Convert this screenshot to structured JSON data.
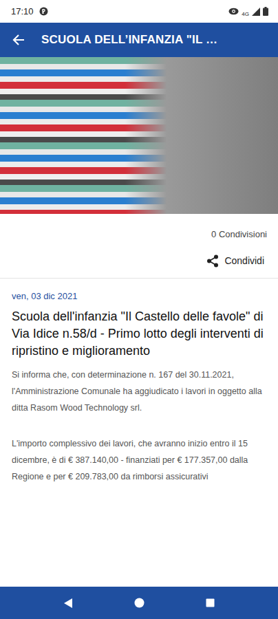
{
  "status_bar": {
    "time": "17:10",
    "network": "4G"
  },
  "app_bar": {
    "title": "SCUOLA DELL’INFANZIA \"IL …"
  },
  "share": {
    "count": "0 Condivisioni",
    "label": "Condividi"
  },
  "article": {
    "date": "ven, 03 dic 2021",
    "title": "Scuola dell'infanzia \"Il Castello delle favole\" di Via Idice n.58/d - Primo lotto degli interventi di ripristino e miglioramento",
    "paragraphs": [
      "Si informa che, con determinazione n. 167 del 30.11.2021, l'Amministrazione Comunale ha aggiudicato i lavori in oggetto alla ditta Rasom Wood Technology srl.",
      "L'importo complessivo dei  lavori, che avranno inizio entro il 15 dicembre,  è di € 387.140,00  - finanziati per € 177.357,00 dalla Regione e per € 209.783,00 da rimborsi assicurativi"
    ]
  }
}
